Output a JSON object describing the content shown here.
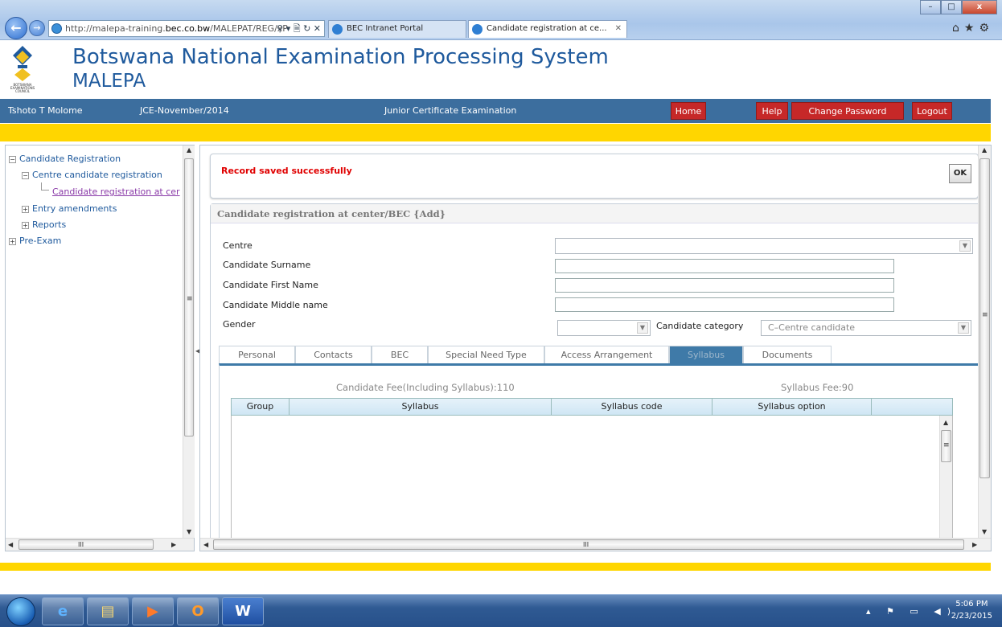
{
  "browser": {
    "address_prefix": "http://malepa-training.",
    "address_domain": "bec.co.bw",
    "address_path": "/MALEPAT/REG/xP",
    "address_tools": "⚲ ▾ 🗎 ↻ ✕",
    "tabs": [
      {
        "label": "BEC Intranet Portal"
      },
      {
        "label": "Candidate registration at ce...",
        "close": "✕"
      }
    ],
    "window_buttons": {
      "minimize": "–",
      "maximize": "□",
      "close": "x"
    },
    "icons": [
      "home-icon",
      "favorites-star-icon",
      "tools-gear-icon"
    ]
  },
  "app": {
    "title": "Botswana National Examination Processing System",
    "subtitle": "MALEPA",
    "logo_text": "BOTSWANA EXAMINATIONS COUNCIL"
  },
  "topbar": {
    "user": "Tshoto T Molome",
    "session": "JCE-November/2014",
    "exam": "Junior Certificate Examination",
    "home": "Home",
    "help": "Help",
    "change_password": "Change Password",
    "logout": "Logout",
    "bar_color": "#3c6e9e",
    "button_color": "#c62828"
  },
  "sidebar": {
    "items": [
      {
        "label": "Candidate Registration",
        "expander": "−"
      },
      {
        "label": "Centre candidate registration",
        "expander": "−"
      },
      {
        "label": "Candidate registration at cer"
      },
      {
        "label": "Entry amendments",
        "expander": "+"
      },
      {
        "label": "Reports",
        "expander": "+"
      },
      {
        "label": "Pre-Exam",
        "expander": "+"
      }
    ]
  },
  "message": {
    "text": "Record saved successfully",
    "ok": "OK"
  },
  "form": {
    "title": "Candidate registration at center/BEC {Add}",
    "labels": {
      "centre": "Centre",
      "surname": "Candidate Surname",
      "first_name": "Candidate First Name",
      "middle_name": "Candidate Middle name",
      "gender": "Gender",
      "category": "Candidate category"
    },
    "values": {
      "centre": "",
      "surname": "",
      "first_name": "",
      "middle_name": "",
      "gender": "",
      "category": "C–Centre candidate"
    },
    "tabs": [
      {
        "label": "Personal"
      },
      {
        "label": "Contacts"
      },
      {
        "label": "BEC"
      },
      {
        "label": "Special Need Type"
      },
      {
        "label": "Access Arrangement"
      },
      {
        "label": "Syllabus",
        "active": true
      },
      {
        "label": "Documents"
      }
    ],
    "candidate_fee": "Candidate Fee(Including Syllabus):110",
    "syllabus_fee": "Syllabus Fee:90",
    "grid_columns": [
      "Group",
      "Syllabus",
      "Syllabus code",
      "Syllabus option"
    ]
  },
  "scrollbars": {
    "grip": "≡",
    "hgrip": "III"
  },
  "taskbar": {
    "apps": [
      {
        "icon": "internet-explorer-icon",
        "glyph": "e"
      },
      {
        "icon": "file-explorer-icon",
        "glyph": "▤"
      },
      {
        "icon": "media-player-icon",
        "glyph": "▶"
      },
      {
        "icon": "outlook-icon",
        "glyph": "O"
      },
      {
        "icon": "word-icon",
        "glyph": "W"
      }
    ],
    "tray": "▴ ⚑ ▭ ◀)",
    "time": "5:06 PM",
    "date": "2/23/2015"
  },
  "colors": {
    "accent_yellow": "#ffd600",
    "title_blue": "#1f5a9d",
    "error_red": "#e00000",
    "tab_active": "#3f7aa8"
  }
}
